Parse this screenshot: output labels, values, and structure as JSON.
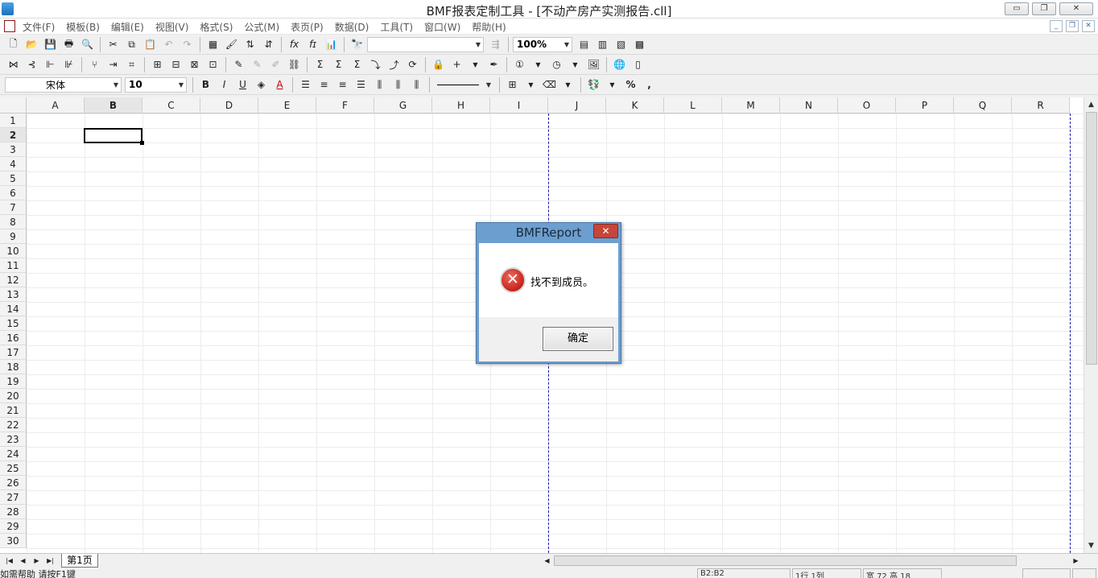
{
  "window": {
    "title": "BMF报表定制工具 - [不动产房产实测报告.cll]",
    "minimize": "▭",
    "restore": "❐",
    "close": "✕"
  },
  "menu": {
    "items": [
      "文件(F)",
      "模板(B)",
      "编辑(E)",
      "视图(V)",
      "格式(S)",
      "公式(M)",
      "表页(P)",
      "数据(D)",
      "工具(T)",
      "窗口(W)",
      "帮助(H)"
    ],
    "mdi_minimize": "_",
    "mdi_restore": "❐",
    "mdi_close": "✕"
  },
  "toolbar1": {
    "zoom_value": "100%",
    "find_value": ""
  },
  "toolbar3": {
    "font_name": "宋体",
    "font_size": "10",
    "bold": "B",
    "italic": "I",
    "underline": "U",
    "font_color": "A",
    "percent": "%",
    "comma": ","
  },
  "sheet": {
    "columns": [
      "A",
      "B",
      "C",
      "D",
      "E",
      "F",
      "G",
      "H",
      "I",
      "J",
      "K",
      "L",
      "M",
      "N",
      "O",
      "P",
      "Q",
      "R"
    ],
    "rows": [
      "1",
      "2",
      "3",
      "4",
      "5",
      "6",
      "7",
      "8",
      "9",
      "10",
      "11",
      "12",
      "13",
      "14",
      "15",
      "16",
      "17",
      "18",
      "19",
      "20",
      "21",
      "22",
      "23",
      "24",
      "25",
      "26",
      "27",
      "28",
      "29",
      "30"
    ],
    "active_cell": "B2",
    "active_column": "B",
    "active_row": "2",
    "sheet_tab": "第1页"
  },
  "dialog": {
    "title": "BMFReport",
    "close_glyph": "✕",
    "icon_glyph": "✕",
    "message": "找不到成员。",
    "ok_label": "确定"
  },
  "statusbar": {
    "help_text": "如需帮助 请按F1键",
    "cell_ref": "B2:B2",
    "row_col": "1行 1列",
    "size": "宽 72 高 18"
  },
  "colors": {
    "dialog_frame": "#6d9ed0",
    "close_button": "#c7453a",
    "error_icon": "#c4231a",
    "page_break": "#1a1aa0"
  }
}
